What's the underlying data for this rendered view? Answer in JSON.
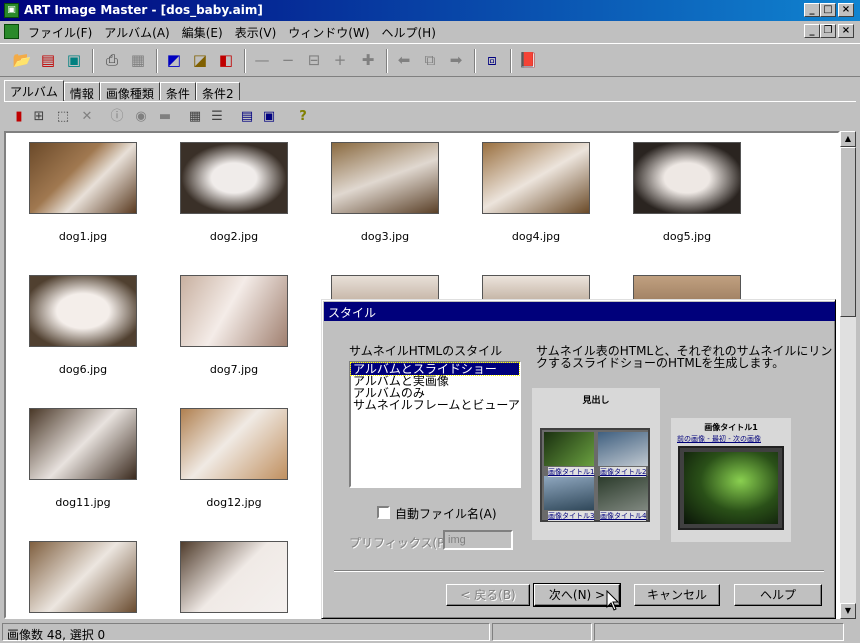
{
  "window": {
    "title": "ART Image Master - [dos_baby.aim]",
    "caption_minimize": "_",
    "caption_maximize": "□",
    "caption_close": "×",
    "mdi_minimize": "_",
    "mdi_restore": "❐",
    "mdi_close": "×"
  },
  "menu": [
    {
      "label": "ファイル(F)"
    },
    {
      "label": "アルバム(A)"
    },
    {
      "label": "編集(E)"
    },
    {
      "label": "表示(V)"
    },
    {
      "label": "ウィンドウ(W)"
    },
    {
      "label": "ヘルプ(H)"
    }
  ],
  "tabs": [
    {
      "label": "アルバム",
      "active": true
    },
    {
      "label": "情報"
    },
    {
      "label": "画像種類"
    },
    {
      "label": "条件"
    },
    {
      "label": "条件2"
    }
  ],
  "thumbnails": [
    {
      "file": "dog1.jpg"
    },
    {
      "file": "dog2.jpg"
    },
    {
      "file": "dog3.jpg"
    },
    {
      "file": "dog4.jpg"
    },
    {
      "file": "dog5.jpg"
    },
    {
      "file": "dog6.jpg"
    },
    {
      "file": "dog7.jpg"
    },
    {
      "file": "dog11.jpg"
    },
    {
      "file": "dog12.jpg"
    }
  ],
  "status": {
    "text": "画像数 48, 選択 0"
  },
  "dialog": {
    "title": "スタイル",
    "style_label": "サムネイルHTMLのスタイル",
    "description_line1": "サムネイル表のHTMLと、それぞれのサムネイルにリン",
    "description_line2": "クするスライドショーのHTMLを生成します。",
    "options": [
      {
        "label": "アルバムとスライドショー",
        "selected": true
      },
      {
        "label": "アルバムと実画像"
      },
      {
        "label": "アルバムのみ"
      },
      {
        "label": "サムネイルフレームとビューア"
      }
    ],
    "auto_filename_label": "自動ファイル名(A)",
    "prefix_label": "プリフィックス(P)",
    "prefix_value": "img",
    "preview": {
      "album_heading": "見出し",
      "captions": [
        "画像タイトル1",
        "画像タイトル2",
        "画像タイトル3",
        "画像タイトル4"
      ],
      "slide_title": "画像タイトル1",
      "slide_nav": "前の画像 - 最初 - 次の画像"
    },
    "buttons": {
      "back": "< 戻る(B)",
      "next": "次へ(N) >",
      "cancel": "キャンセル",
      "help": "ヘルプ"
    }
  },
  "colors": {
    "title_active": "#00007b",
    "face": "#c0c0c0",
    "selection": "#00007b"
  }
}
